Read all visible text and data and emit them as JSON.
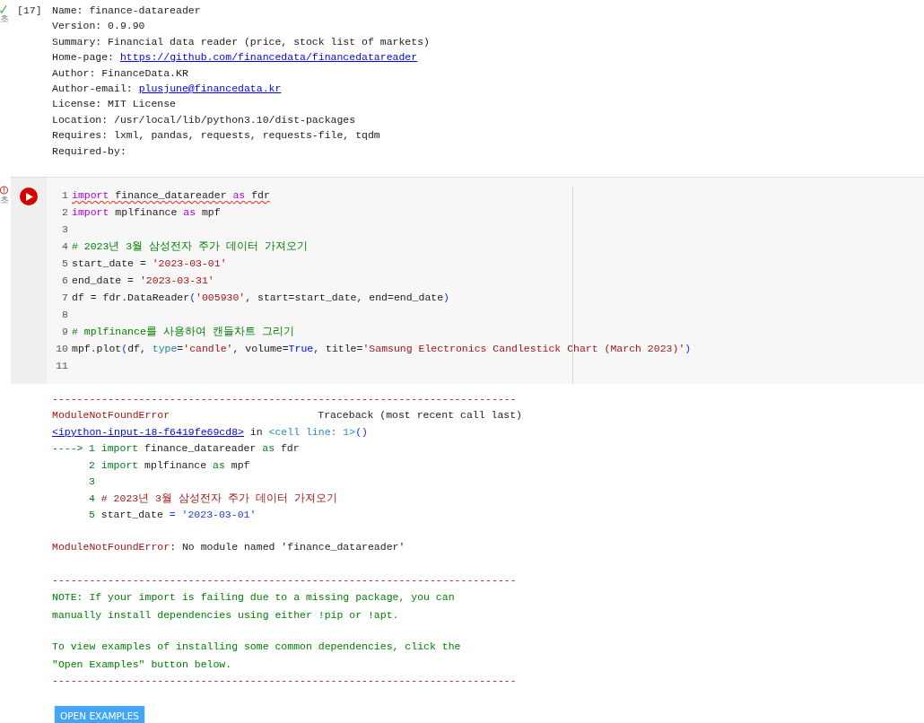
{
  "output_cell": {
    "status": {
      "kind": "success",
      "elapsed": "초"
    },
    "exec_count": "[17]",
    "lines": [
      [
        {
          "text": "Name: finance-datareader",
          "kind": "plain"
        }
      ],
      [
        {
          "text": "Version: 0.9.90",
          "kind": "plain"
        }
      ],
      [
        {
          "text": "Summary: Financial data reader (price, stock list of markets)",
          "kind": "plain"
        }
      ],
      [
        {
          "text": "Home-page: ",
          "kind": "plain"
        },
        {
          "text": "https://github.com/financedata/financedatareader",
          "kind": "link"
        }
      ],
      [
        {
          "text": "Author: FinanceData.KR",
          "kind": "plain"
        }
      ],
      [
        {
          "text": "Author-email: ",
          "kind": "plain"
        },
        {
          "text": "plusjune@financedata.kr",
          "kind": "link"
        }
      ],
      [
        {
          "text": "License: MIT License",
          "kind": "plain"
        }
      ],
      [
        {
          "text": "Location: /usr/local/lib/python3.10/dist-packages",
          "kind": "plain"
        }
      ],
      [
        {
          "text": "Requires: lxml, pandas, requests, requests-file, tqdm",
          "kind": "plain"
        }
      ],
      [
        {
          "text": "Required-by:",
          "kind": "plain"
        }
      ]
    ]
  },
  "code_cell": {
    "status": {
      "kind": "error",
      "elapsed": "초"
    },
    "lines": [
      {
        "number": "1",
        "squiggle": true,
        "tokens": [
          {
            "text": "import",
            "kind": "keyword"
          },
          {
            "text": " finance_datareader ",
            "kind": "plain"
          },
          {
            "text": "as",
            "kind": "keyword"
          },
          {
            "text": " fdr",
            "kind": "plain"
          }
        ]
      },
      {
        "number": "2",
        "squiggle": false,
        "tokens": [
          {
            "text": "import",
            "kind": "keyword"
          },
          {
            "text": " mplfinance ",
            "kind": "plain"
          },
          {
            "text": "as",
            "kind": "keyword"
          },
          {
            "text": " mpf",
            "kind": "plain"
          }
        ]
      },
      {
        "number": "3"
      },
      {
        "number": "4",
        "squiggle": false,
        "tokens": [
          {
            "text": "# 2023년 3월 삼성전자 주가 데이터 가져오기",
            "kind": "comment"
          }
        ]
      },
      {
        "number": "5",
        "squiggle": false,
        "tokens": [
          {
            "text": "start_date = ",
            "kind": "plain"
          },
          {
            "text": "'2023-03-01'",
            "kind": "string"
          }
        ]
      },
      {
        "number": "6",
        "squiggle": false,
        "tokens": [
          {
            "text": "end_date = ",
            "kind": "plain"
          },
          {
            "text": "'2023-03-31'",
            "kind": "string"
          }
        ]
      },
      {
        "number": "7",
        "squiggle": false,
        "tokens": [
          {
            "text": "df = fdr.DataReader",
            "kind": "plain"
          },
          {
            "text": "(",
            "kind": "paren"
          },
          {
            "text": "'005930'",
            "kind": "string"
          },
          {
            "text": ", start=start_date, end=end_date",
            "kind": "plain"
          },
          {
            "text": ")",
            "kind": "paren"
          }
        ]
      },
      {
        "number": "8"
      },
      {
        "number": "9",
        "squiggle": false,
        "tokens": [
          {
            "text": "# mplfinance를 사용하여 캔들차트 그리기",
            "kind": "comment"
          }
        ]
      },
      {
        "number": "10",
        "squiggle": false,
        "tokens": [
          {
            "text": "mpf.plot",
            "kind": "plain"
          },
          {
            "text": "(",
            "kind": "paren"
          },
          {
            "text": "df, ",
            "kind": "plain"
          },
          {
            "text": "type",
            "kind": "param"
          },
          {
            "text": "=",
            "kind": "plain"
          },
          {
            "text": "'candle'",
            "kind": "string"
          },
          {
            "text": ", volume=",
            "kind": "plain"
          },
          {
            "text": "True",
            "kind": "builtin"
          },
          {
            "text": ", title=",
            "kind": "plain"
          },
          {
            "text": "'Samsung Electronics Candlestick Chart (March 2023)'",
            "kind": "string"
          },
          {
            "text": ")",
            "kind": "paren"
          }
        ]
      },
      {
        "number": "11"
      }
    ]
  },
  "error_output": {
    "rule_top": "---------------------------------------------------------------------------",
    "error_name": "ModuleNotFoundError",
    "traceback_label": "Traceback (most recent call last)",
    "location": [
      {
        "text": "<ipython-input-18-f6419fe69cd8>",
        "kind": "link"
      },
      {
        "text": " in ",
        "kind": "plain"
      },
      {
        "text": "<cell line: 1>",
        "kind": "cellref"
      },
      {
        "text": "()",
        "kind": "paren"
      }
    ],
    "context": [
      {
        "arrow": "---->",
        "number": "1",
        "tokens": [
          {
            "text": "import",
            "kind": "tbkeyword"
          },
          {
            "text": " finance_datareader ",
            "kind": "plain"
          },
          {
            "text": "as",
            "kind": "tbkeyword"
          },
          {
            "text": " fdr",
            "kind": "plain"
          }
        ]
      },
      {
        "number": "2",
        "tokens": [
          {
            "text": "import",
            "kind": "tbkeyword"
          },
          {
            "text": " mplfinance ",
            "kind": "plain"
          },
          {
            "text": "as",
            "kind": "tbkeyword"
          },
          {
            "text": " mpf",
            "kind": "plain"
          }
        ]
      },
      {
        "number": "3"
      },
      {
        "number": "4",
        "tokens": [
          {
            "text": "# 2023년 3월 삼성전자 주가 데이터 가져오기",
            "kind": "tbcomment"
          }
        ]
      },
      {
        "number": "5",
        "tokens": [
          {
            "text": "start_date ",
            "kind": "plain"
          },
          {
            "text": "=",
            "kind": "tbop"
          },
          {
            "text": " '2023-03-01'",
            "kind": "tbstring"
          }
        ]
      }
    ],
    "message": [
      {
        "text": "ModuleNotFoundError",
        "kind": "error"
      },
      {
        "text": ": No module named 'finance_datareader'",
        "kind": "plain"
      }
    ],
    "rule_middle": "---------------------------------------------------------------------------",
    "notes": [
      "NOTE: If your import is failing due to a missing package, you can\nmanually install dependencies using either !pip or !apt.",
      "To view examples of installing some common dependencies, click the\n\"Open Examples\" button below."
    ],
    "rule_bottom": "---------------------------------------------------------------------------",
    "button": "OPEN EXAMPLES"
  }
}
